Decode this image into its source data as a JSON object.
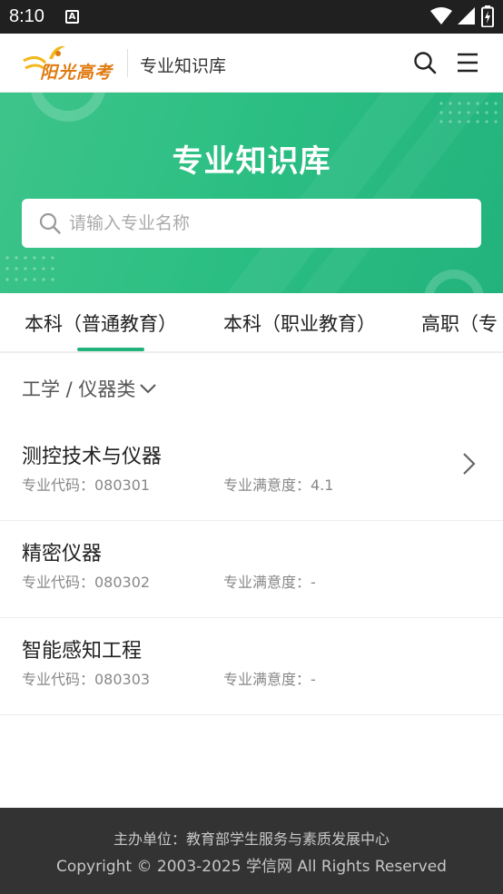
{
  "status_bar": {
    "time": "8:10",
    "notification_letter": "A"
  },
  "header": {
    "logo_text": "阳光高考",
    "title": "专业知识库"
  },
  "banner": {
    "title": "专业知识库",
    "search_placeholder": "请输入专业名称",
    "search_value": ""
  },
  "tabs": [
    {
      "label": "本科（普通教育）",
      "active": true
    },
    {
      "label": "本科（职业教育）",
      "active": false
    },
    {
      "label": "高职（专",
      "active": false
    }
  ],
  "category": {
    "label": "工学 / 仪器类"
  },
  "majors": [
    {
      "name": "测控技术与仪器",
      "code_label": "专业代码：080301",
      "satisfaction_label": "专业满意度：4.1",
      "has_arrow": true
    },
    {
      "name": "精密仪器",
      "code_label": "专业代码：080302",
      "satisfaction_label": "专业满意度：-",
      "has_arrow": false
    },
    {
      "name": "智能感知工程",
      "code_label": "专业代码：080303",
      "satisfaction_label": "专业满意度：-",
      "has_arrow": false
    }
  ],
  "footer": {
    "line1": "主办单位：教育部学生服务与素质发展中心",
    "line2": "Copyright © 2003-2025 学信网 All Rights Reserved"
  },
  "colors": {
    "accent": "#22b37c",
    "footer_bg": "#333333",
    "logo": "#e07a10"
  },
  "icons": {
    "wifi": "wifi-icon",
    "signal": "signal-icon",
    "battery": "battery-icon",
    "search": "search-icon",
    "menu": "menu-icon",
    "chevron_down": "chevron-down-icon",
    "chevron_right": "chevron-right-icon"
  }
}
